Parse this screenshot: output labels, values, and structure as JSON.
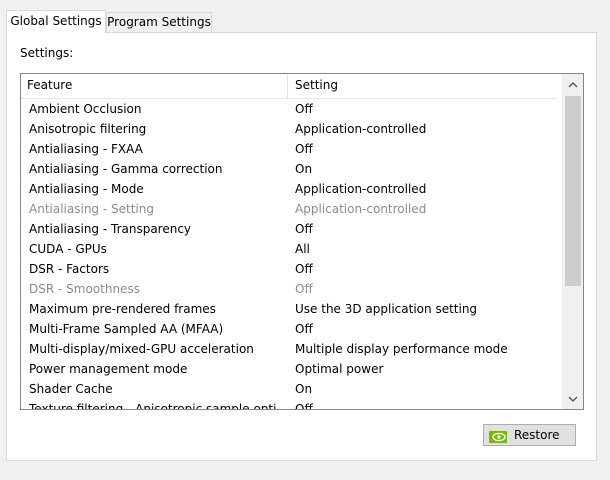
{
  "tabs": [
    {
      "label": "Global Settings",
      "active": true
    },
    {
      "label": "Program Settings",
      "active": false
    }
  ],
  "settings_label": "Settings:",
  "columns": {
    "feature": "Feature",
    "setting": "Setting"
  },
  "rows": [
    {
      "feature": "Ambient Occlusion",
      "setting": "Off",
      "enabled": true
    },
    {
      "feature": "Anisotropic filtering",
      "setting": "Application-controlled",
      "enabled": true
    },
    {
      "feature": "Antialiasing - FXAA",
      "setting": "Off",
      "enabled": true
    },
    {
      "feature": "Antialiasing - Gamma correction",
      "setting": "On",
      "enabled": true
    },
    {
      "feature": "Antialiasing - Mode",
      "setting": "Application-controlled",
      "enabled": true
    },
    {
      "feature": "Antialiasing - Setting",
      "setting": "Application-controlled",
      "enabled": false
    },
    {
      "feature": "Antialiasing - Transparency",
      "setting": "Off",
      "enabled": true
    },
    {
      "feature": "CUDA - GPUs",
      "setting": "All",
      "enabled": true
    },
    {
      "feature": "DSR - Factors",
      "setting": "Off",
      "enabled": true
    },
    {
      "feature": "DSR - Smoothness",
      "setting": "Off",
      "enabled": false
    },
    {
      "feature": "Maximum pre-rendered frames",
      "setting": "Use the 3D application setting",
      "enabled": true
    },
    {
      "feature": "Multi-Frame Sampled AA (MFAA)",
      "setting": "Off",
      "enabled": true
    },
    {
      "feature": "Multi-display/mixed-GPU acceleration",
      "setting": "Multiple display performance mode",
      "enabled": true
    },
    {
      "feature": "Power management mode",
      "setting": "Optimal power",
      "enabled": true
    },
    {
      "feature": "Shader Cache",
      "setting": "On",
      "enabled": true
    },
    {
      "feature": "Texture filtering - Anisotropic sample opti",
      "setting": "Off",
      "enabled": true
    }
  ],
  "restore_button": {
    "label": "Restore",
    "icon": "nvidia-icon"
  },
  "colors": {
    "nvidia_green": "#76b900"
  }
}
